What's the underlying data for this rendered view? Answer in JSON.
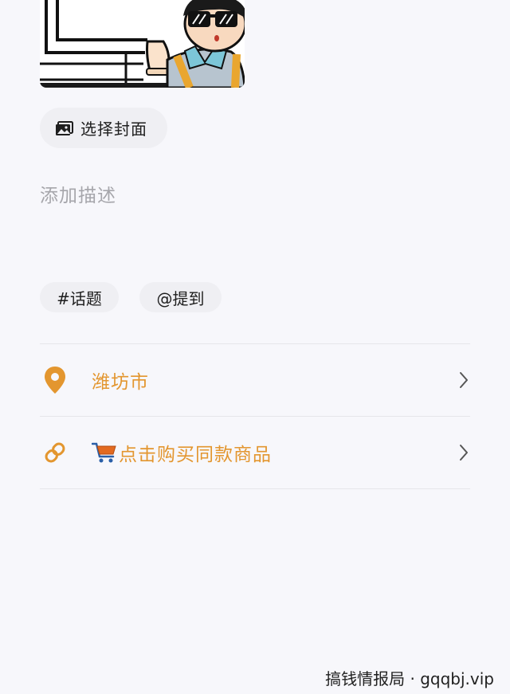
{
  "cover": {
    "image": "cartoon-man-with-sunglasses"
  },
  "select_cover": {
    "icon": "image-icon",
    "label": "选择封面"
  },
  "description": {
    "placeholder": "添加描述"
  },
  "chips": {
    "topic": "#话题",
    "mention": "@提到"
  },
  "location_row": {
    "icon": "location-pin-icon",
    "label": "潍坊市"
  },
  "product_row": {
    "icon": "link-icon",
    "label": "点击购买同款商品"
  },
  "colors": {
    "accent": "#e3962f",
    "background": "#f7f7fb",
    "chip_bg": "#efeff3"
  },
  "watermark": "搞钱情报局 · gqqbj.vip"
}
